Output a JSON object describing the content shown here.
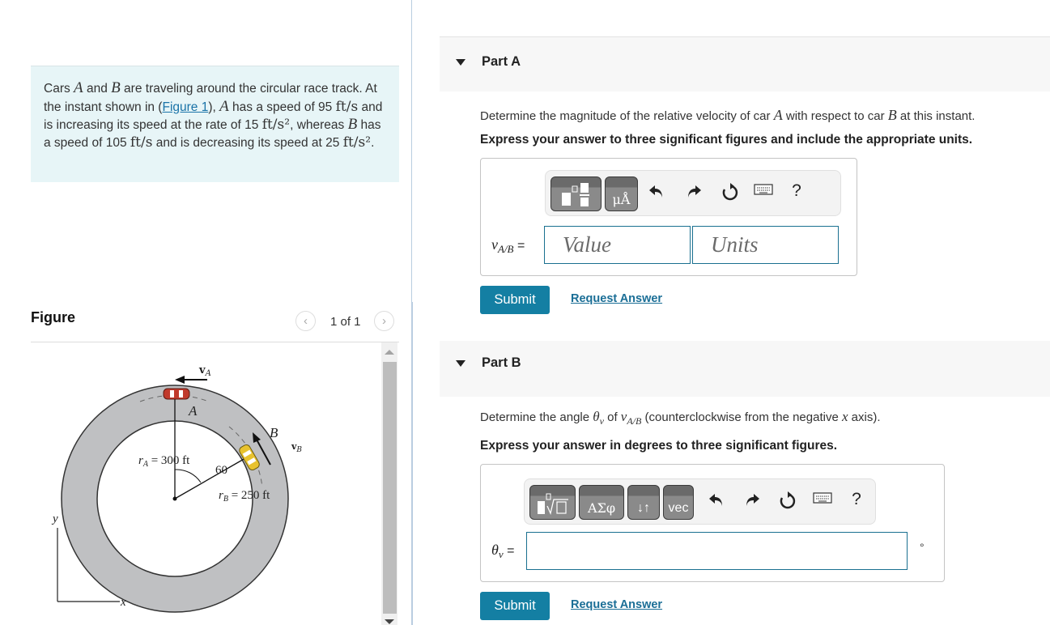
{
  "problem": {
    "text_1": "Cars ",
    "var_A": "A",
    "text_2": " and ",
    "var_B": "B",
    "text_3": " are traveling around the circular race track. At the instant shown in (",
    "figure_link": "Figure 1",
    "text_4": "), ",
    "var_A2": "A",
    "text_5": " has a speed of 95 ",
    "unit_fts": "ft/s",
    "text_6": " and is increasing its speed at the rate of 15 ",
    "unit_fts2": "ft/s²",
    "text_7": ", whereas ",
    "var_B2": "B",
    "text_8": " has a speed of 105 ",
    "unit_fts_b": "ft/s",
    "text_9": " and is decreasing its speed at 25 ",
    "unit_fts2_b": "ft/s²",
    "text_10": "."
  },
  "figure_panel": {
    "title": "Figure",
    "pager_text": "1 of 1",
    "prev_icon": "chevron-left-icon",
    "next_icon": "chevron-right-icon",
    "labels": {
      "vA": "v",
      "vA_sub": "A",
      "car_A": "A",
      "car_B": "B",
      "vB": "v",
      "vB_sub": "B",
      "rA": "r",
      "rA_sub": "A",
      "rA_value": " = 300 ft",
      "angle": "60",
      "rB": "r",
      "rB_sub": "B",
      "rB_value": " = 250 ft",
      "axis_y": "y",
      "axis_x": "x"
    }
  },
  "part_a": {
    "title": "Part A",
    "question_1": "Determine the magnitude of the relative velocity of car ",
    "question_var_A": "A",
    "question_2": " with respect to car ",
    "question_var_B": "B",
    "question_3": " at this instant.",
    "instruction": "Express your answer to three significant figures and include the appropriate units.",
    "toolbar": {
      "template_icon": "fraction-template-icon",
      "units_label": "μÅ",
      "undo_icon": "undo-icon",
      "redo_icon": "redo-icon",
      "reset_icon": "reset-icon",
      "keyboard_icon": "keyboard-icon",
      "help_label": "?"
    },
    "eq_var": "v",
    "eq_sub": "A/B",
    "eq_sign": " =",
    "value_placeholder": "Value",
    "value": "",
    "units_placeholder": "Units",
    "units": "",
    "submit_label": "Submit",
    "request_label": "Request Answer"
  },
  "part_b": {
    "title": "Part B",
    "question_1": "Determine the angle ",
    "question_theta": "θ",
    "question_theta_sub": "v",
    "question_2": " of ",
    "question_v": "v",
    "question_v_sub": "A/B",
    "question_3": " (counterclockwise from the negative ",
    "question_x": "x",
    "question_4": " axis).",
    "instruction": "Express your answer in degrees to three significant figures.",
    "toolbar": {
      "template_icon": "radical-template-icon",
      "greek_label": "ΑΣφ",
      "arrows_label": "↓↑",
      "vec_label": "vec",
      "undo_icon": "undo-icon",
      "redo_icon": "redo-icon",
      "reset_icon": "reset-icon",
      "keyboard_icon": "keyboard-icon",
      "help_label": "?"
    },
    "eq_var": "θ",
    "eq_sub": "v",
    "eq_sign": " =",
    "value": "",
    "degree_symbol": "°",
    "submit_label": "Submit",
    "request_label": "Request Answer"
  },
  "colors": {
    "problem_bg": "#e7f5f7",
    "accent": "#147fa3",
    "link": "#1a6e96",
    "input_border": "#1a7090",
    "part_header_bg": "#f7f7f7"
  }
}
